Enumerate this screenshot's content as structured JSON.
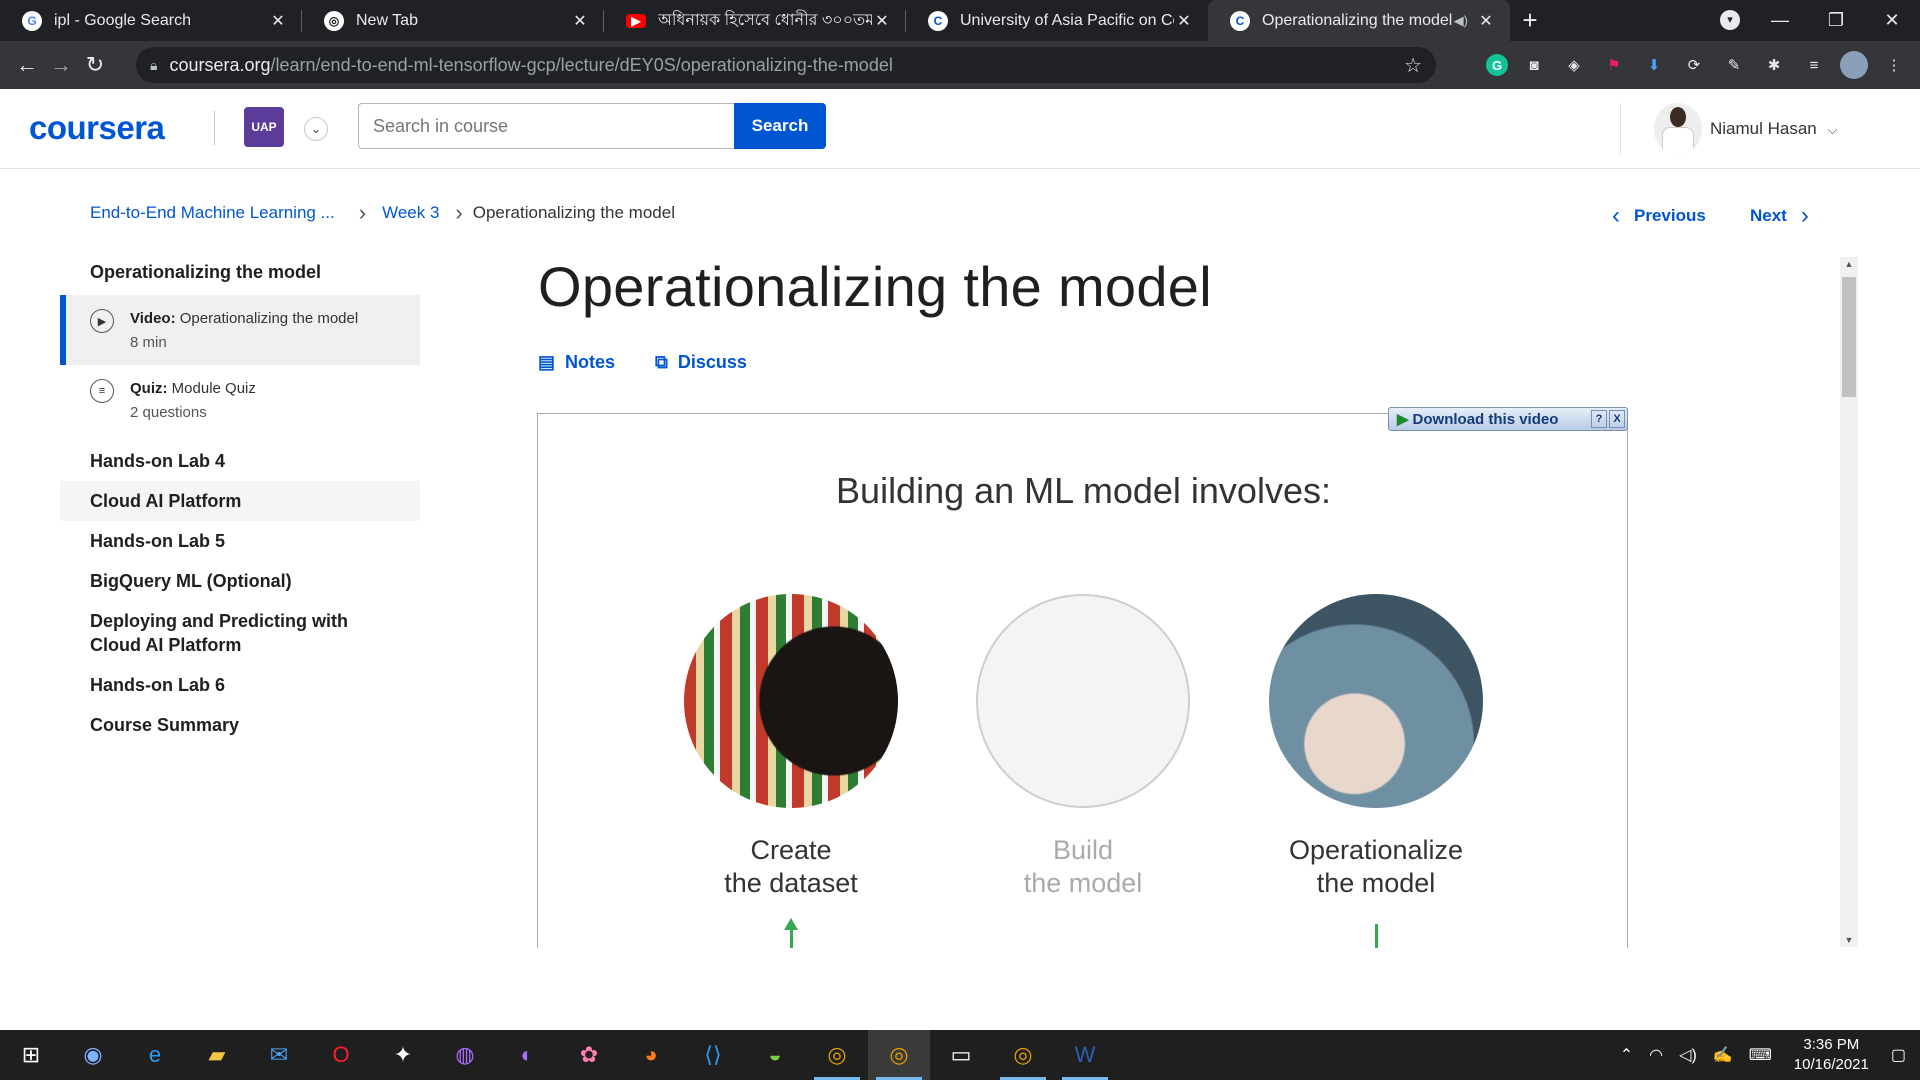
{
  "browser": {
    "tabs": [
      {
        "title": "ipl - Google Search",
        "favicon": "google-icon",
        "color": "#ffffff"
      },
      {
        "title": "New Tab",
        "favicon": "chrome-icon",
        "color": "#ffffff"
      },
      {
        "title": "অধিনায়ক হিসেবে ধোনীর ৩০০তম",
        "favicon": "youtube-icon",
        "color": "#ff0000"
      },
      {
        "title": "University of Asia Pacific on Coursera",
        "favicon": "coursera-icon",
        "color": "#0056d2"
      },
      {
        "title": "Operationalizing the model | Coursera",
        "favicon": "coursera-icon",
        "color": "#0056d2"
      }
    ],
    "url_host": "coursera.org",
    "url_path": "/learn/end-to-end-ml-tensorflow-gcp/lecture/dEY0S/operationalizing-the-model"
  },
  "header": {
    "logo": "coursera",
    "university_badge": "UAP",
    "search_placeholder": "Search in course",
    "search_button": "Search",
    "user_name": "Niamul Hasan"
  },
  "breadcrumb": {
    "course": "End-to-End Machine Learning ...",
    "week": "Week 3",
    "current": "Operationalizing the model",
    "previous": "Previous",
    "next": "Next"
  },
  "sidebar": {
    "section": "Operationalizing the model",
    "items": [
      {
        "kind": "Video:",
        "title": "Operationalizing the model",
        "meta": "8 min"
      },
      {
        "kind": "Quiz:",
        "title": "Module Quiz",
        "meta": "2 questions"
      }
    ],
    "modules": [
      "Hands-on Lab 4",
      "Cloud AI Platform",
      "Hands-on Lab 5",
      "BigQuery ML (Optional)",
      "Deploying and Predicting with Cloud AI Platform",
      "Hands-on Lab 6",
      "Course Summary"
    ]
  },
  "main": {
    "title": "Operationalizing the model",
    "notes": "Notes",
    "discuss": "Discuss",
    "download_bar": "Download this video",
    "slide": {
      "heading": "Building an ML model involves:",
      "steps": [
        {
          "line1": "Create",
          "line2": "the dataset"
        },
        {
          "line1": "Build",
          "line2": "the model"
        },
        {
          "line1": "Operationalize",
          "line2": "the model"
        }
      ]
    }
  },
  "taskbar": {
    "time": "3:36 PM",
    "date": "10/16/2021"
  }
}
